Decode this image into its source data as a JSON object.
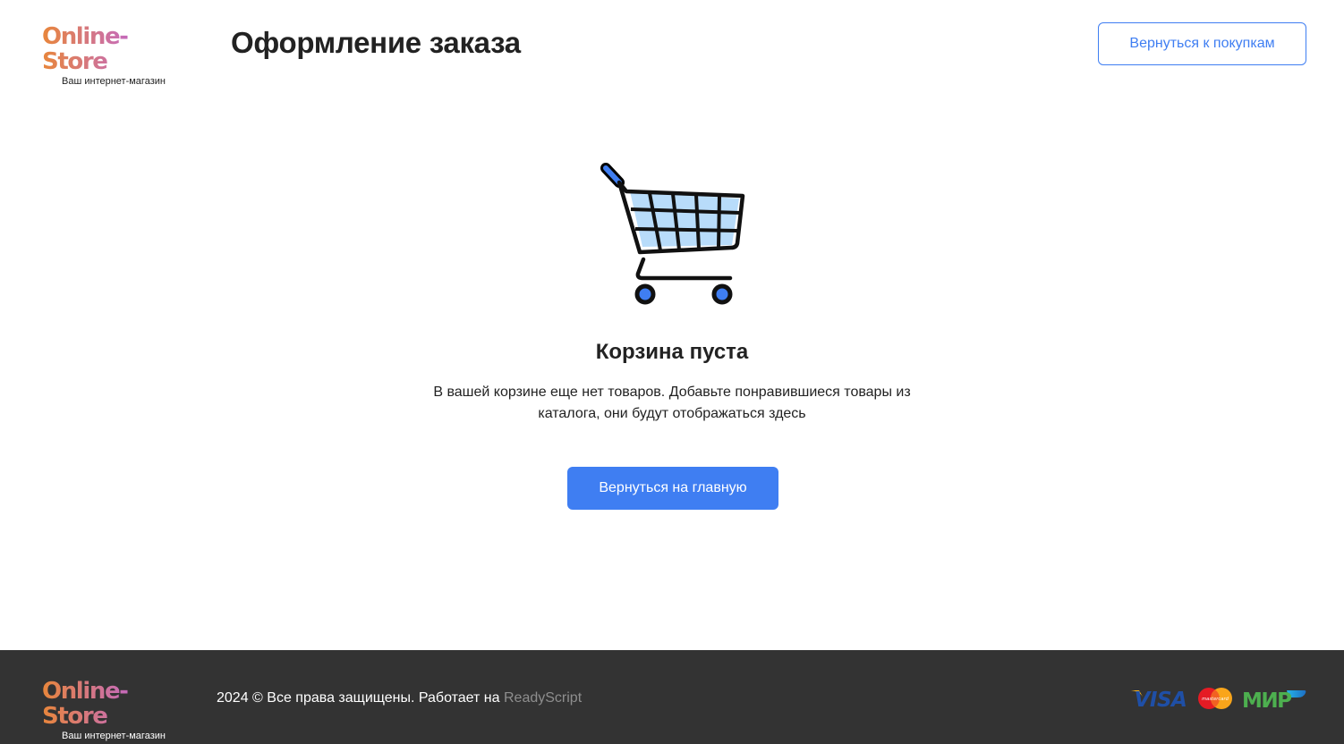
{
  "header": {
    "logo": {
      "name": "Online-Store",
      "tagline": "Ваш интернет-магазин"
    },
    "title": "Оформление заказа",
    "back_to_shopping": "Вернуться к покупкам"
  },
  "main": {
    "icon": "shopping-cart-icon",
    "empty_title": "Корзина пуста",
    "empty_text": "В вашей корзине еще нет товаров. Добавьте понравившиеся товары из каталога, они будут отображаться здесь",
    "home_button": "Вернуться на главную"
  },
  "footer": {
    "logo": {
      "name": "Online-Store",
      "tagline": "Ваш интернет-магазин"
    },
    "copyright": "2024 © Все права защищены. Работает на",
    "powered_by": "ReadyScript",
    "payment_icons": [
      "visa-icon",
      "mastercard-icon",
      "mir-icon"
    ],
    "payment": {
      "visa": "VISA",
      "mastercard": "mastercard",
      "mir": "МИР"
    }
  },
  "colors": {
    "accent": "#3f7ef2",
    "footer_bg": "#333333",
    "cart_fill": "#b8dcfa",
    "logo_gradient_start": "#e8863b",
    "logo_gradient_end": "#a13ce6"
  }
}
